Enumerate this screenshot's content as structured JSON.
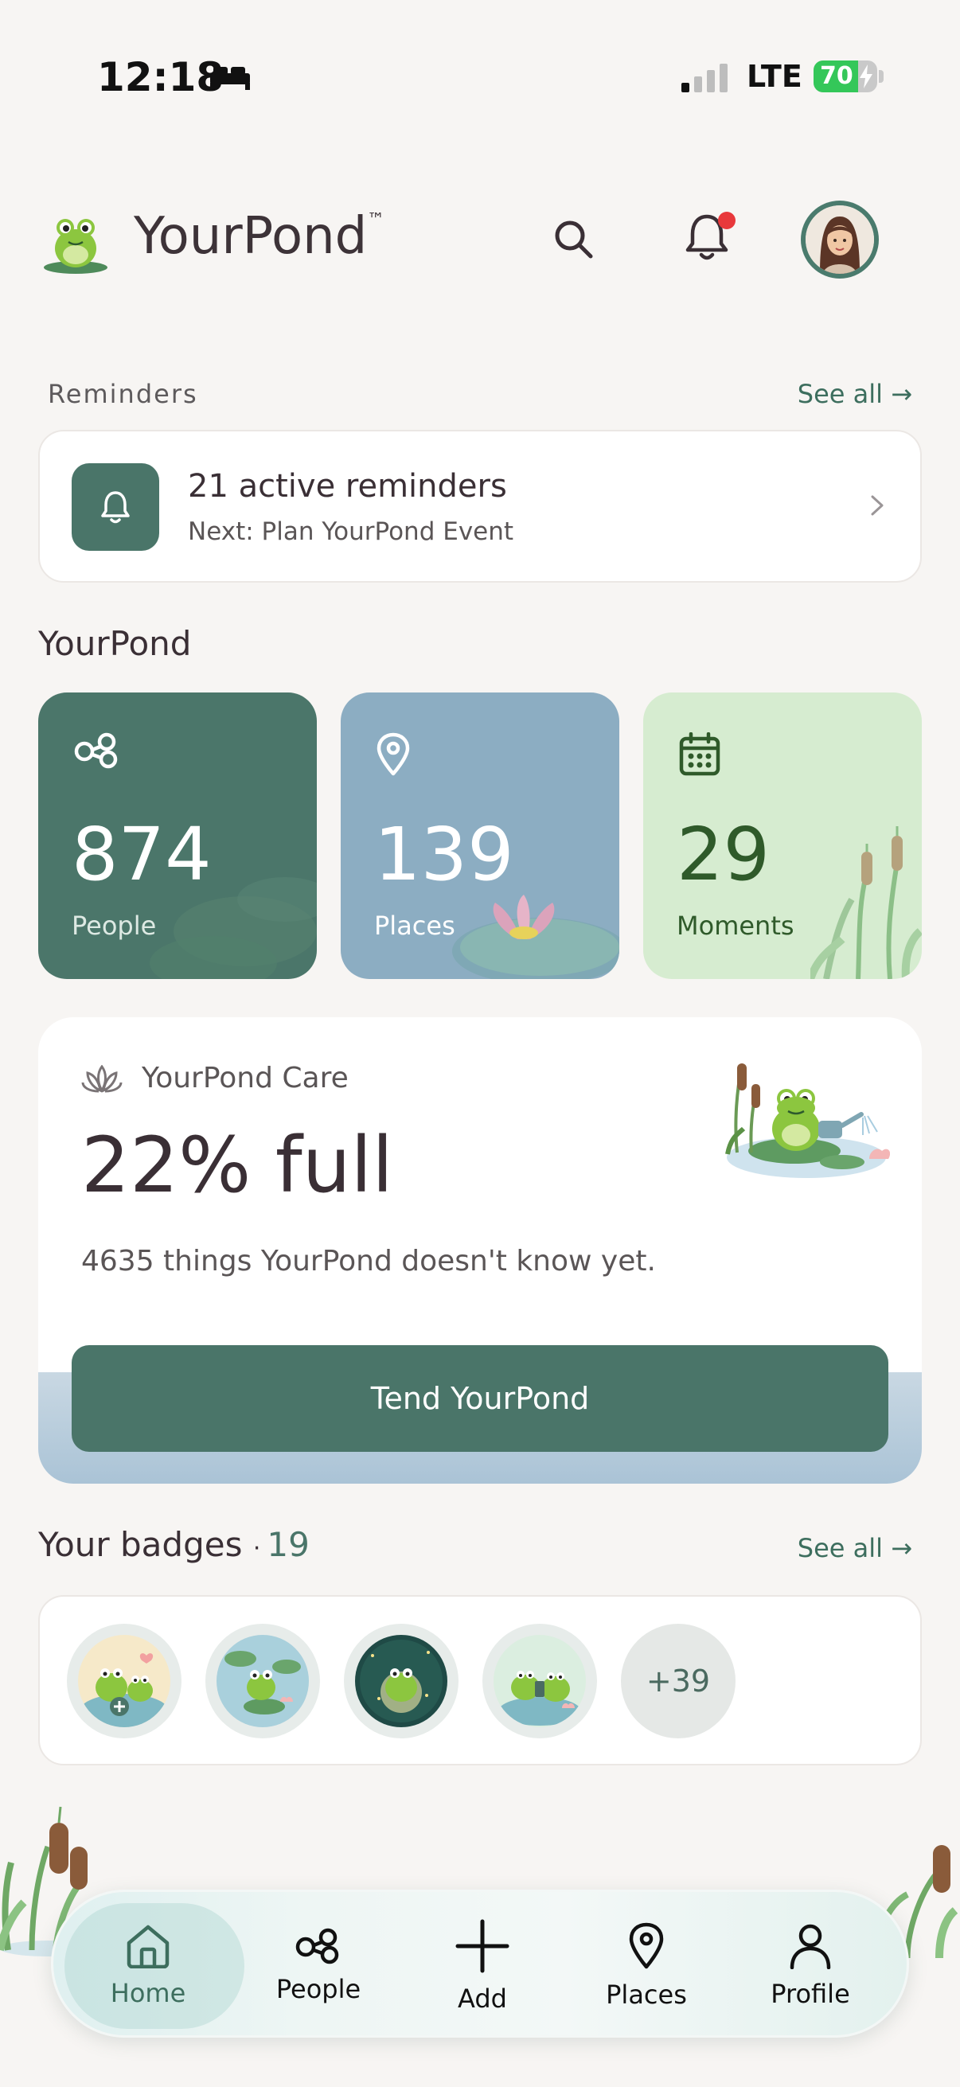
{
  "status_bar": {
    "time": "12:18",
    "network": "LTE",
    "battery": "70"
  },
  "header": {
    "app_name": "YourPond",
    "trademark": "™"
  },
  "reminders": {
    "section_label": "Reminders",
    "see_all": "See all →",
    "title": "21 active reminders",
    "next": "Next: Plan YourPond Event"
  },
  "pond": {
    "section_label": "YourPond",
    "stats": [
      {
        "value": "874",
        "label": "People"
      },
      {
        "value": "139",
        "label": "Places"
      },
      {
        "value": "29",
        "label": "Moments"
      }
    ]
  },
  "care": {
    "label": "YourPond Care",
    "percent_text": "22% full",
    "description": "4635 things YourPond doesn't know yet.",
    "button": "Tend YourPond"
  },
  "badges": {
    "label": "Your badges",
    "separator": "·",
    "count": "19",
    "see_all": "See all →",
    "more": "+39"
  },
  "nav": {
    "items": [
      {
        "label": "Home",
        "icon": "home-icon"
      },
      {
        "label": "People",
        "icon": "people-icon"
      },
      {
        "label": "Add",
        "icon": "plus-icon"
      },
      {
        "label": "Places",
        "icon": "map-pin-icon"
      },
      {
        "label": "Profile",
        "icon": "person-icon"
      }
    ]
  }
}
